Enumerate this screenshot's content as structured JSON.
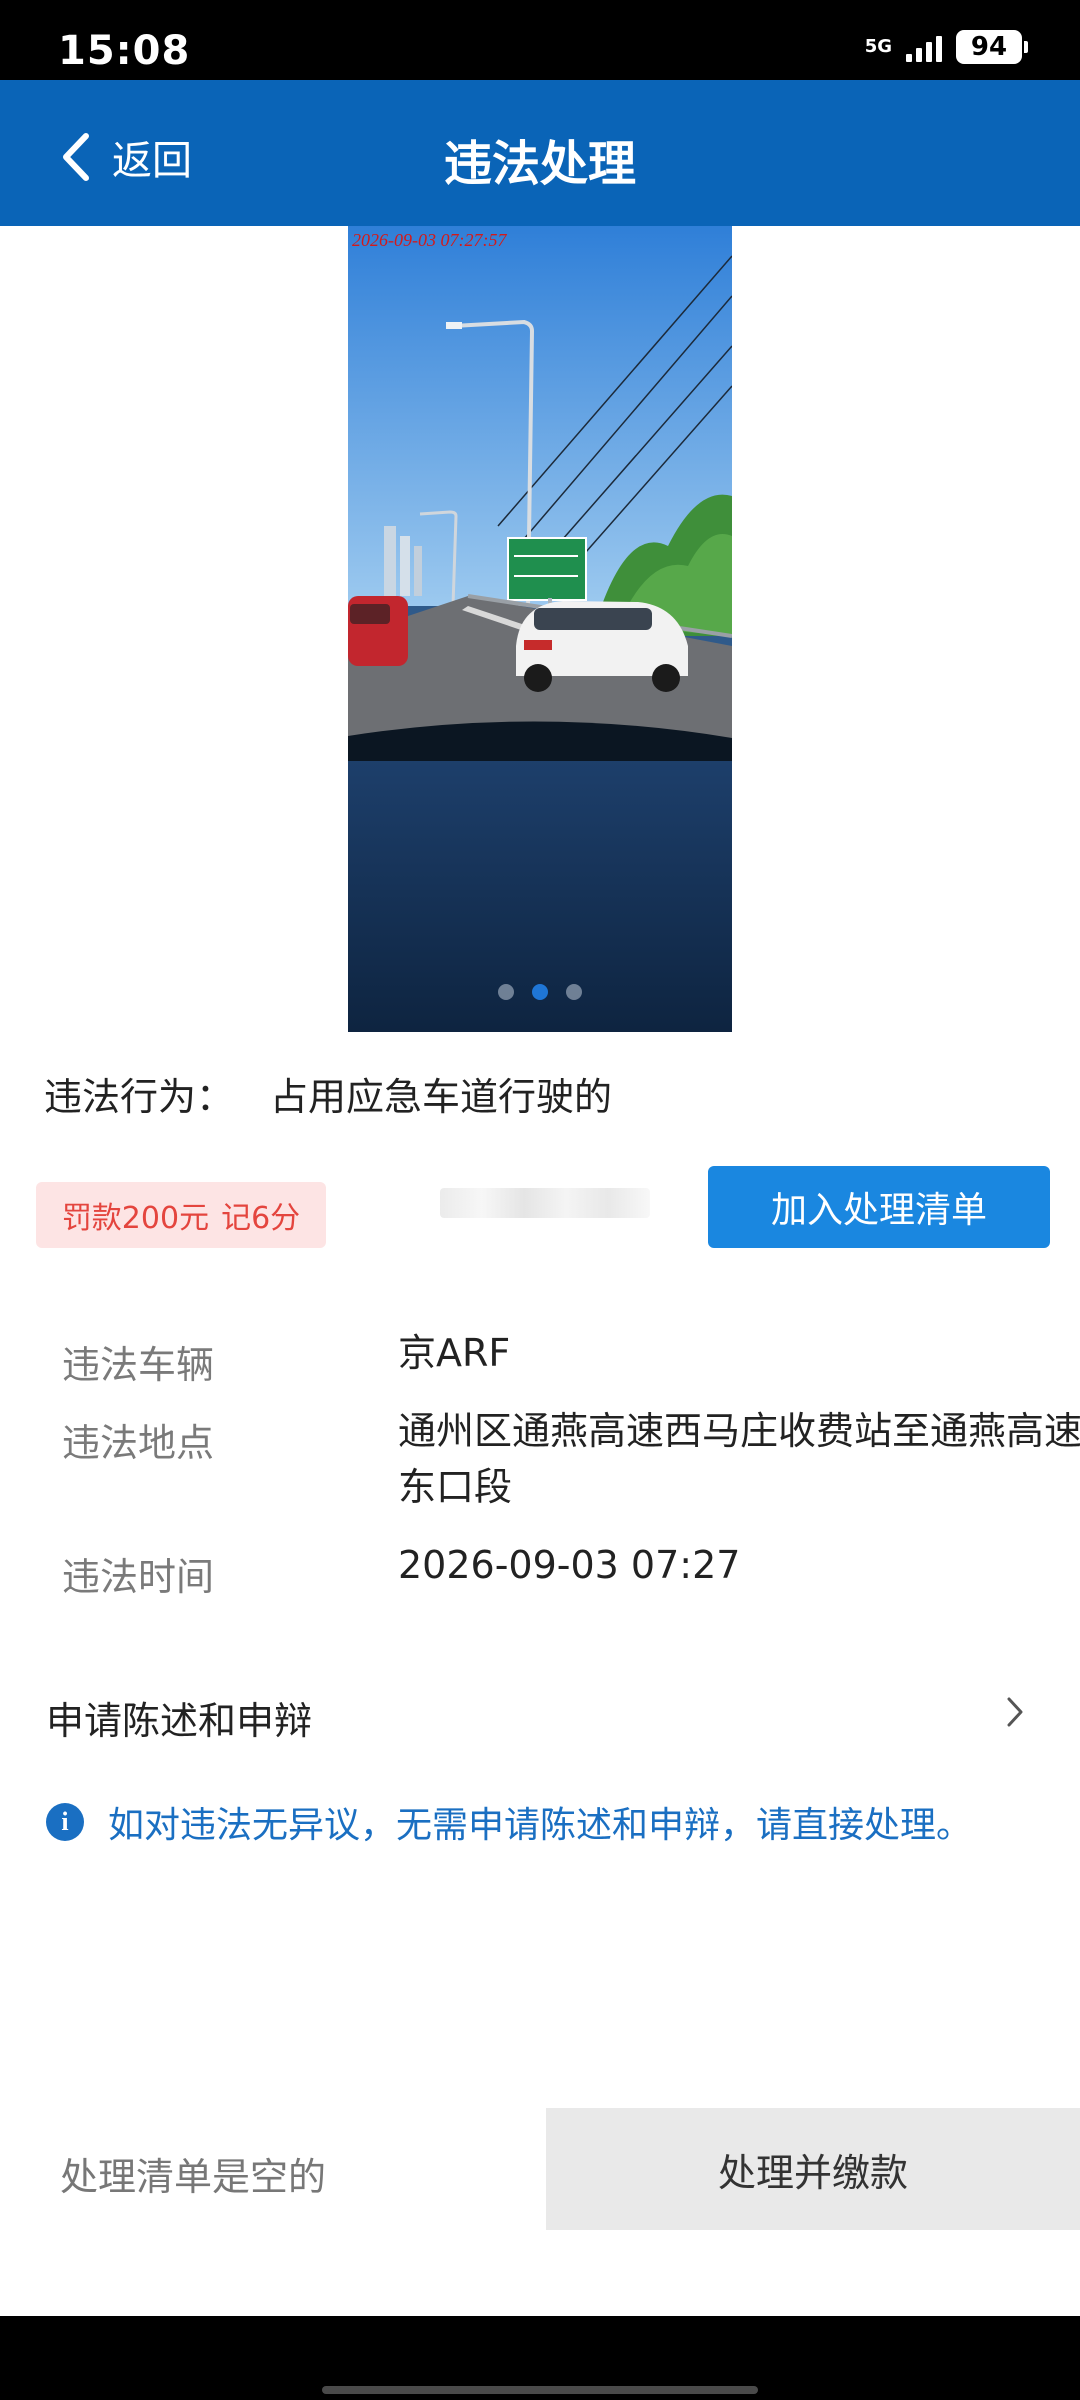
{
  "status_bar": {
    "time": "15:08",
    "network": "5G",
    "battery": "94"
  },
  "header": {
    "back_label": "返回",
    "title": "违法处理"
  },
  "photo": {
    "timestamp": "2026-09-03 07:27:57",
    "page_count": 3,
    "active_index": 1
  },
  "violation": {
    "behavior_label": "违法行为：",
    "behavior_value": "占用应急车道行驶的",
    "fine": "罚款200元",
    "points": "记6分",
    "add_button": "加入处理清单"
  },
  "details": [
    {
      "label": "违法车辆",
      "value": "京ARF"
    },
    {
      "label": "违法地点",
      "value": "通州区通燕高速西马庄收费站至通燕高速东口段"
    },
    {
      "label": "违法时间",
      "value": "2026-09-03 07:27"
    }
  ],
  "appeal": {
    "label": "申请陈述和申辩"
  },
  "notice": {
    "text": "如对违法无异议，无需申请陈述和申辩，请直接处理。"
  },
  "footer": {
    "empty_text": "处理清单是空的",
    "pay_button": "处理并缴款"
  },
  "colors": {
    "brand_blue": "#0a64b7",
    "button_blue": "#1a87e0",
    "fine_red": "#e4453e",
    "notice_blue": "#1a6fc2"
  }
}
